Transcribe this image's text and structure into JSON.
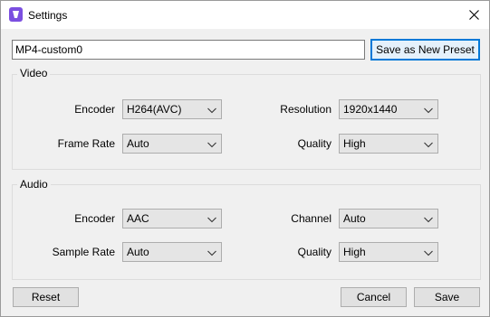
{
  "window": {
    "title": "Settings",
    "app_icon": "app-logo-icon",
    "close_icon": "close-icon"
  },
  "preset": {
    "name_value": "MP4-custom0",
    "save_new_label": "Save as New Preset"
  },
  "video": {
    "group_label": "Video",
    "encoder": {
      "label": "Encoder",
      "value": "H264(AVC)"
    },
    "framerate": {
      "label": "Frame Rate",
      "value": "Auto"
    },
    "resolution": {
      "label": "Resolution",
      "value": "1920x1440"
    },
    "quality": {
      "label": "Quality",
      "value": "High"
    }
  },
  "audio": {
    "group_label": "Audio",
    "encoder": {
      "label": "Encoder",
      "value": "AAC"
    },
    "samplerate": {
      "label": "Sample Rate",
      "value": "Auto"
    },
    "channel": {
      "label": "Channel",
      "value": "Auto"
    },
    "quality": {
      "label": "Quality",
      "value": "High"
    }
  },
  "footer": {
    "reset_label": "Reset",
    "cancel_label": "Cancel",
    "save_label": "Save"
  },
  "colors": {
    "accent": "#0078d7",
    "icon_purple": "#7b4fe0",
    "window_bg": "#f0f0f0"
  }
}
